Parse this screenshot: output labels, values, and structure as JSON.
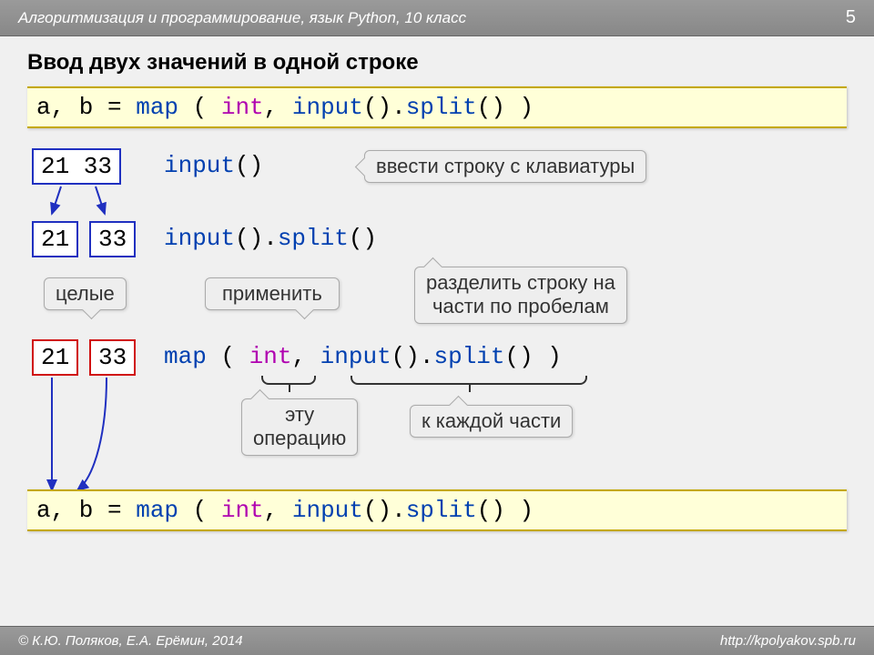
{
  "header": {
    "text": "Алгоритмизация и программирование, язык Python, 10 класс",
    "page": "5"
  },
  "title": "Ввод двух значений в одной строке",
  "code": {
    "line_ab": "a, b = ",
    "map": "map",
    "int": "int",
    "input": "input",
    "split": "split",
    "full_label": "a, b = map ( int, input().split() )"
  },
  "vals": {
    "joined": "21 33",
    "v1": "21",
    "v2": "33"
  },
  "callouts": {
    "c1": "ввести строку с клавиатуры",
    "c2": "целые",
    "c3": "применить",
    "c4": "разделить строку на части по пробелам",
    "c5": "эту операцию",
    "c6": "к каждой части"
  },
  "footer": {
    "author": "© К.Ю. Поляков, Е.А. Ерёмин, 2014",
    "url": "http://kpolyakov.spb.ru"
  }
}
